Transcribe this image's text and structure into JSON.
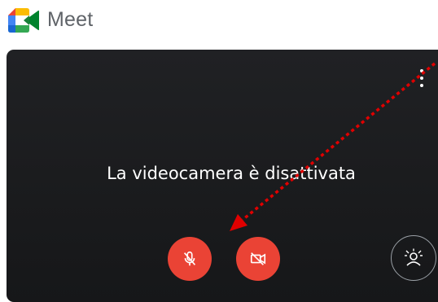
{
  "app": {
    "title": "Meet"
  },
  "preview": {
    "message": "La videocamera è disattivata",
    "background": "#202124"
  },
  "controls": {
    "mic": {
      "icon": "mic-off-icon",
      "state": "off",
      "color": "#ea4335"
    },
    "camera": {
      "icon": "videocam-off-icon",
      "state": "off",
      "color": "#ea4335"
    },
    "effects": {
      "icon": "visual-effects-icon"
    },
    "more": {
      "icon": "more-vert-icon"
    }
  },
  "annotation": {
    "color": "#e00000",
    "style": "dotted-arrow"
  }
}
